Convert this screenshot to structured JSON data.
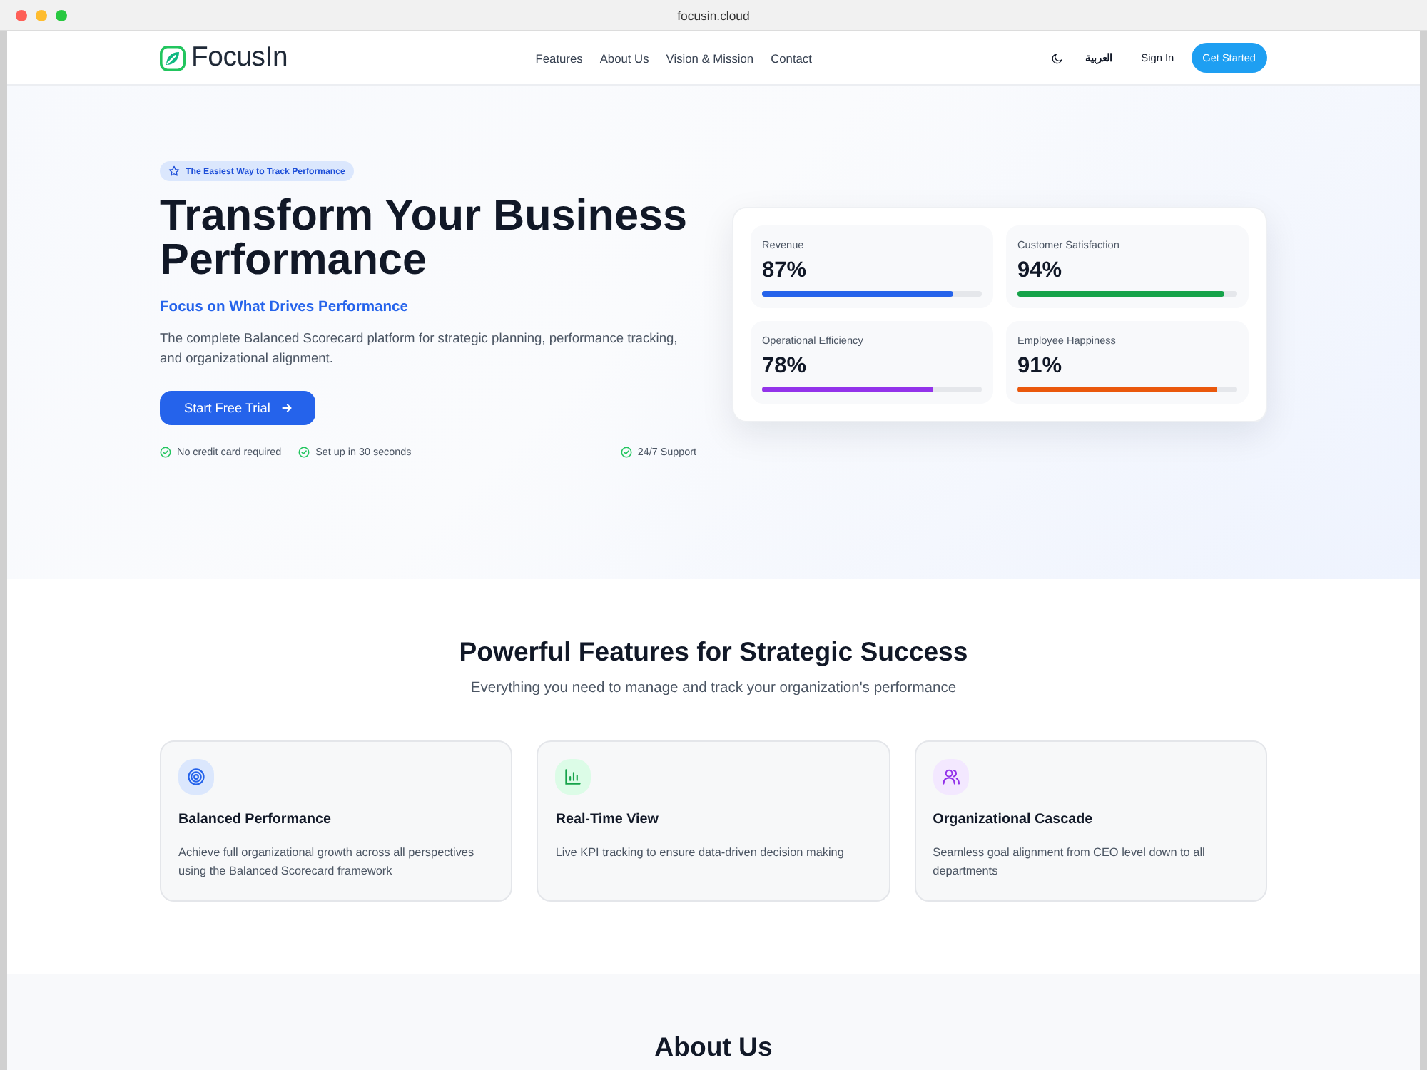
{
  "window": {
    "title": "focusin.cloud"
  },
  "nav": {
    "logo": "FocusIn",
    "links": [
      "Features",
      "About Us",
      "Vision & Mission",
      "Contact"
    ],
    "language": "العربية",
    "sign_in": "Sign In",
    "cta": "Get Started"
  },
  "hero": {
    "badge": "The Easiest Way to Track Performance",
    "title": "Transform Your Business Performance",
    "subtitle": "Focus on What Drives Performance",
    "description": "The complete Balanced Scorecard platform for strategic planning, performance tracking, and organizational alignment.",
    "button": "Start Free Trial",
    "perks": [
      "No credit card required",
      "Set up in 30 seconds",
      "24/7 Support"
    ]
  },
  "metrics": [
    {
      "label": "Revenue",
      "value": "87%",
      "level": 0.87,
      "color": "#2563eb"
    },
    {
      "label": "Customer Satisfaction",
      "value": "94%",
      "level": 0.94,
      "color": "#16a34a"
    },
    {
      "label": "Operational Efficiency",
      "value": "78%",
      "level": 0.78,
      "color": "#9333ea"
    },
    {
      "label": "Employee Happiness",
      "value": "91%",
      "level": 0.91,
      "color": "#ea580c"
    }
  ],
  "features": {
    "title": "Powerful Features for Strategic Success",
    "subtitle": "Everything you need to manage and track your organization's performance",
    "cards": [
      {
        "kind": "target",
        "title": "Balanced Performance",
        "description": "Achieve full organizational growth across all perspectives using the Balanced Scorecard framework"
      },
      {
        "kind": "chart",
        "title": "Real-Time View",
        "description": "Live KPI tracking to ensure data-driven decision making"
      },
      {
        "kind": "users",
        "title": "Organizational Cascade",
        "description": "Seamless goal alignment from CEO level down to all departments"
      }
    ]
  },
  "about": {
    "title": "About Us"
  }
}
